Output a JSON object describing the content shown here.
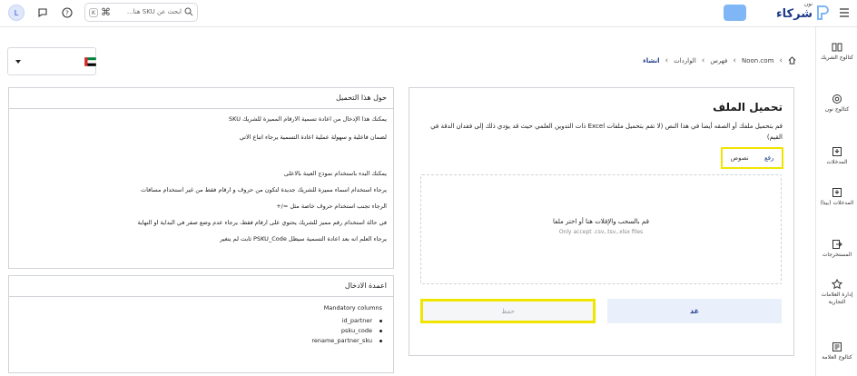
{
  "topbar": {
    "avatar_initial": "L",
    "search_shortcut_key": "K",
    "search_shortcut_cmd": "⌘",
    "search_placeholder": "ابحث عن SKU هنا...",
    "logo_small": "نون",
    "logo_text": "شركاء",
    "icons": [
      "help-icon",
      "chat-icon",
      "search-icon",
      "menu-icon"
    ],
    "accent_color": "#7fb6f5"
  },
  "breadcrumb": {
    "items": [
      "Noon.com",
      "فهرس",
      "الواردات",
      "انشاء"
    ]
  },
  "country_select": {
    "selected": "UAE"
  },
  "about_panel": {
    "title": "حول هذا التحميل",
    "lines": [
      "يمكنك هذا الإدخال من اعادة تسمية الارقام المميزة للشريك SKU",
      "لضمان فاعلية و سهولة عملية اعادة التسمية يرجاء اتباع الاتي",
      "",
      "يمكنك البدء باستخدام نموذج العينة بالاعلى",
      "يرجاء استخدام اسماء مميزة للشريك جديدة لتكون من حروف و ارقام فقط من غير استخدام مسافات",
      "الرجاء تجنب استخدام حروف خاصة مثل =/+",
      "في حالة استخدام رقم مميز للشريك يحتوي على ارقام فقط، يرجاء عدم وضع صفر في البداية او النهاية",
      "يرجاء العلم انه بعد اعادة التسمية سيظل PSKU_Code ثابت لم يتغير"
    ]
  },
  "columns_panel": {
    "title": "اعمدة الادخال",
    "subtitle": "Mandatory columns",
    "columns": [
      "id_partner",
      "psku_code",
      "rename_partner_sku"
    ]
  },
  "upload": {
    "title": "تحميل الملف",
    "description": "قم بتحميل ملفك أو الصقه أيضا في هذا النص (لا تقم بتحميل ملفات Excel ذات التدوين العلمي حيث قد يؤدي ذلك إلى فقدان الدقة في القيم)",
    "tab_file": "رفع",
    "tab_text": "نصوص",
    "dropzone_text": "قم بالسحب والإفلات هنا أو اختر ملفا",
    "dropzone_hint": "Only accept .csv,.tsv,.xlsx files",
    "save_label": "حفظ",
    "cancel_label": "غد",
    "highlight_color": "#f0e500"
  },
  "sidebar": {
    "items": [
      {
        "label": "كتالوج الشريك",
        "icon": "catalog-icon"
      },
      {
        "label": "كتالوج نون",
        "icon": "search-catalog-icon"
      },
      {
        "label": "المدخلات",
        "icon": "inbox-icon"
      },
      {
        "label": "المدخلات (بيتا)",
        "icon": "inbox-beta-icon"
      },
      {
        "label": "المستخرجات",
        "icon": "export-icon"
      },
      {
        "label": "إدارة العلامات التجارية",
        "icon": "brand-icon"
      },
      {
        "label": "كتالوج العلامة",
        "icon": "brand-catalog-icon"
      }
    ]
  }
}
